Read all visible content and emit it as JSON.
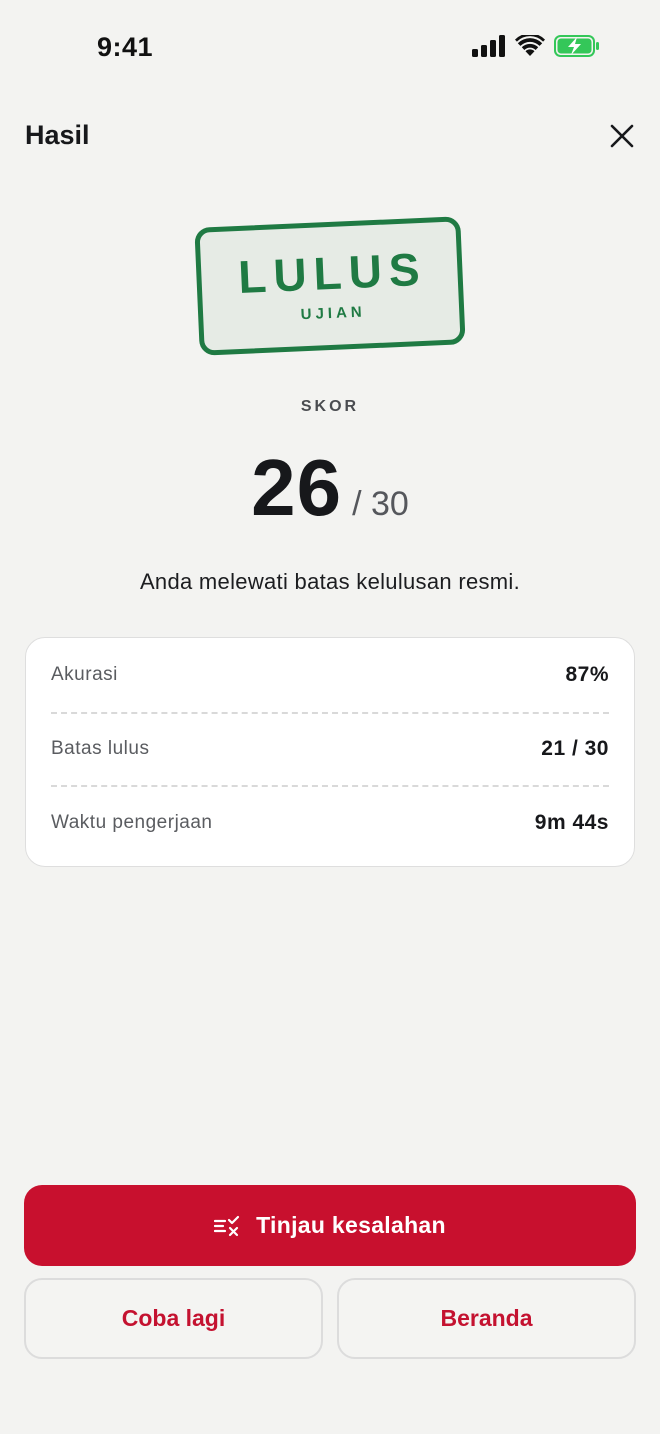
{
  "status_bar": {
    "time": "9:41",
    "icons": [
      "cellular-signal-icon",
      "wifi-icon",
      "battery-charging-icon"
    ]
  },
  "header": {
    "title": "Hasil",
    "close_icon": "close-icon"
  },
  "stamp": {
    "main": "LULUS",
    "sub": "UJIAN",
    "color": "#1f7a43"
  },
  "score": {
    "label": "SKOR",
    "value": "26",
    "total": "/ 30"
  },
  "message": "Anda melewati batas kelulusan resmi.",
  "stats": [
    {
      "label": "Akurasi",
      "value": "87%"
    },
    {
      "label": "Batas lulus",
      "value": "21 / 30"
    },
    {
      "label": "Waktu pengerjaan",
      "value": "9m 44s"
    }
  ],
  "actions": {
    "review_label": "Tinjau kesalahan",
    "review_icon": "review-mistakes-icon",
    "retry_label": "Coba lagi",
    "home_label": "Beranda"
  },
  "colors": {
    "accent": "#c8102e",
    "success": "#1f7a43",
    "background": "#f3f3f1",
    "battery": "#34c759"
  }
}
